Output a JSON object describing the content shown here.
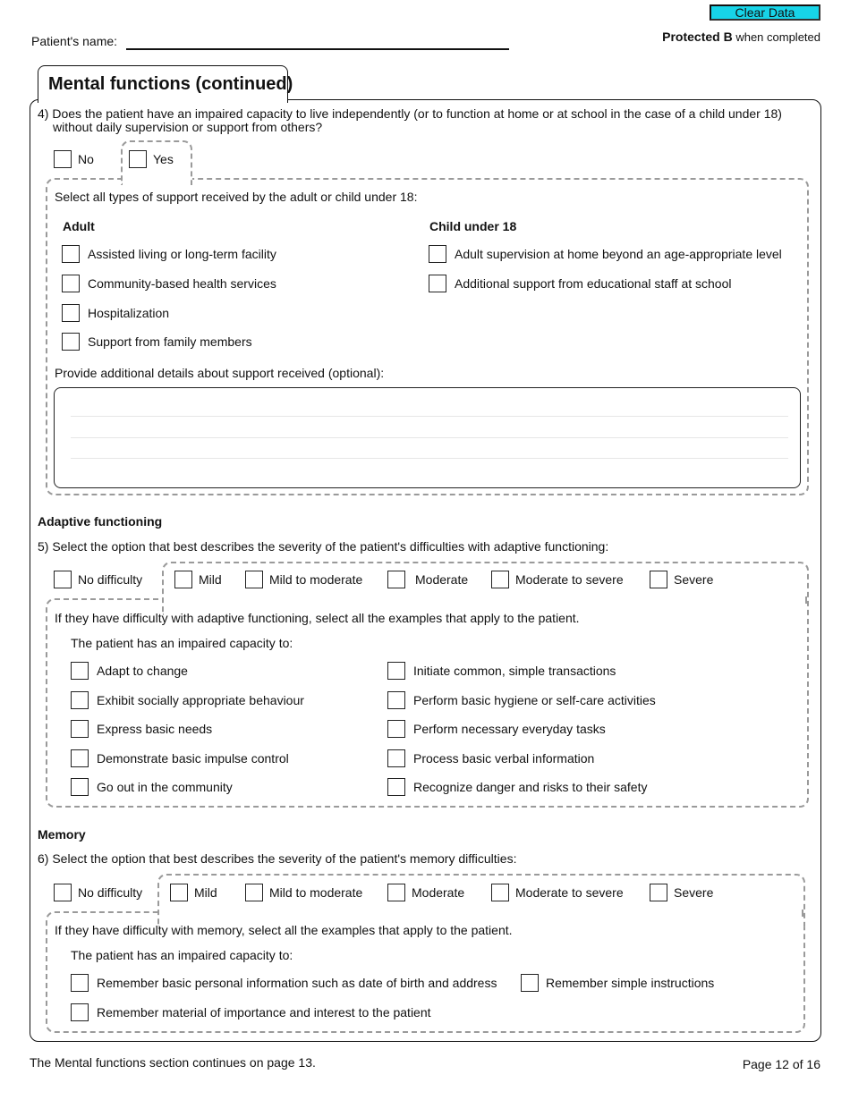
{
  "header": {
    "clear_button": "Clear Data",
    "patient_name_label": "Patient's name:",
    "patient_name_value": "",
    "protected_bold": "Protected B",
    "protected_rest": " when completed"
  },
  "section": {
    "title": "Mental functions (continued)"
  },
  "q4": {
    "text_line1": "4) Does the patient have an impaired capacity to live independently (or to function at home or at school in the case of a child under 18)",
    "text_line2": "without daily supervision or support from others?",
    "options": [
      "No",
      "Yes"
    ],
    "support_prompt": "Select all types of support received by the adult or child under 18:",
    "adult_heading": "Adult",
    "child_heading": "Child under 18",
    "adult_items": [
      "Assisted living or long-term facility",
      "Community-based health services",
      "Hospitalization",
      "Support from family members"
    ],
    "child_items": [
      "Adult supervision at home beyond an age-appropriate level",
      "Additional support from educational staff at school"
    ],
    "details_label": "Provide additional details about support received (optional):",
    "details_value": ""
  },
  "adaptive": {
    "heading": "Adaptive functioning",
    "question": "5) Select the option that best describes the severity of the patient's difficulties with adaptive functioning:",
    "severity": [
      "No difficulty",
      "Mild",
      "Mild to moderate",
      "Moderate",
      "Moderate to severe",
      "Severe"
    ],
    "examples_prompt": "If they have difficulty with adaptive functioning, select all the examples that apply to the patient.",
    "capacity_label": "The patient has an impaired capacity to:",
    "left_items": [
      "Adapt to change",
      "Exhibit socially appropriate behaviour",
      "Express basic needs",
      "Demonstrate basic impulse control",
      "Go out in the community"
    ],
    "right_items": [
      "Initiate common, simple transactions",
      "Perform basic hygiene or self-care activities",
      "Perform necessary everyday tasks",
      "Process basic verbal information",
      "Recognize danger and risks to their safety"
    ]
  },
  "memory": {
    "heading": "Memory",
    "question": "6) Select the option that best describes the severity of the patient's memory difficulties:",
    "severity": [
      "No difficulty",
      "Mild",
      "Mild to moderate",
      "Moderate",
      "Moderate to severe",
      "Severe"
    ],
    "examples_prompt": "If they have difficulty with memory, select all the examples that apply to the patient.",
    "capacity_label": "The patient has an impaired capacity to:",
    "items": [
      "Remember basic personal information such as date of birth and address",
      "Remember simple instructions",
      "Remember material of importance and interest to the patient"
    ]
  },
  "footer": {
    "continues": "The Mental functions section continues on page 13.",
    "page": "Page 12 of 16"
  },
  "colors": {
    "clear_button": "#17d4e8",
    "dashed_border": "#9a9a9a"
  }
}
